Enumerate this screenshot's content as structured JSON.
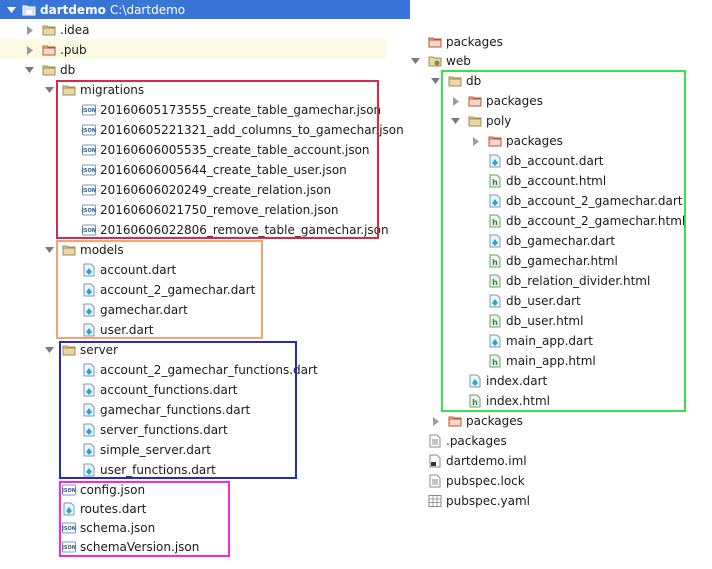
{
  "project": {
    "name": "dartdemo",
    "path": "C:\\dartdemo"
  },
  "left": {
    "idea": ".idea",
    "pub": ".pub",
    "db": "db",
    "migrations": {
      "label": "migrations",
      "files": [
        "20160605173555_create_table_gamechar.json",
        "20160605221321_add_columns_to_gamechar.json",
        "20160606005535_create_table_account.json",
        "20160606005644_create_table_user.json",
        "20160606020249_create_relation.json",
        "20160606021750_remove_relation.json",
        "20160606022806_remove_table_gamechar.json"
      ]
    },
    "models": {
      "label": "models",
      "files": [
        "account.dart",
        "account_2_gamechar.dart",
        "gamechar.dart",
        "user.dart"
      ]
    },
    "server": {
      "label": "server",
      "files": [
        "account_2_gamechar_functions.dart",
        "account_functions.dart",
        "gamechar_functions.dart",
        "server_functions.dart",
        "simple_server.dart",
        "user_functions.dart"
      ]
    },
    "db_files": [
      "config.json",
      "routes.dart",
      "schema.json",
      "schemaVersion.json"
    ]
  },
  "right": {
    "packages": "packages",
    "web": "web",
    "db": "db",
    "db_packages": "packages",
    "poly": "poly",
    "poly_packages": "packages",
    "poly_files": [
      "db_account.dart",
      "db_account.html",
      "db_account_2_gamechar.dart",
      "db_account_2_gamechar.html",
      "db_gamechar.dart",
      "db_gamechar.html",
      "db_relation_divider.html",
      "db_user.dart",
      "db_user.html",
      "main_app.dart",
      "main_app.html"
    ],
    "index_dart": "index.dart",
    "index_html": "index.html",
    "web_packages": "packages",
    "root_files": [
      ".packages",
      "dartdemo.iml",
      "pubspec.lock",
      "pubspec.yaml"
    ]
  },
  "colors": {
    "selection": "#3875d7",
    "migrations_box": "#d9284a",
    "models_box": "#f0a575",
    "server_box": "#2a2ab8",
    "misc_box": "#ec2be6",
    "web_box": "#36e24a"
  }
}
